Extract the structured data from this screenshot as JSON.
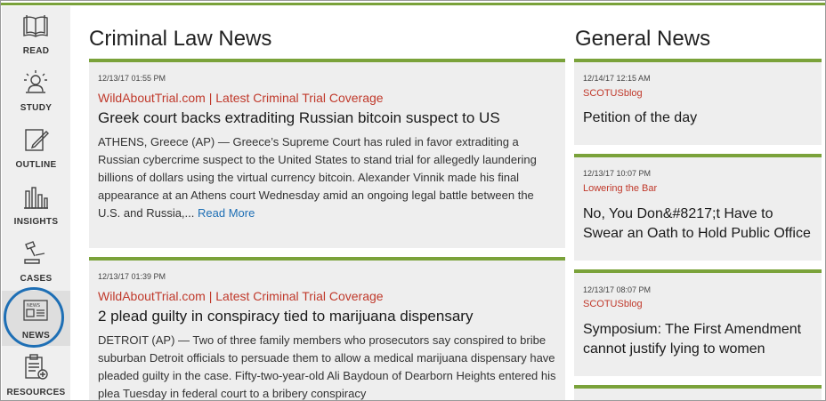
{
  "sidebar": {
    "items": [
      {
        "label": "READ",
        "icon": "book-icon"
      },
      {
        "label": "STUDY",
        "icon": "study-lamp-icon"
      },
      {
        "label": "OUTLINE",
        "icon": "outline-pencil-icon"
      },
      {
        "label": "INSIGHTS",
        "icon": "bar-chart-icon"
      },
      {
        "label": "CASES",
        "icon": "gavel-icon"
      },
      {
        "label": "NEWS",
        "icon": "newspaper-icon"
      },
      {
        "label": "RESOURCES",
        "icon": "clipboard-plus-icon"
      }
    ],
    "active": "NEWS"
  },
  "criminal": {
    "title": "Criminal Law News",
    "articles": [
      {
        "timestamp": "12/13/17 01:55 PM",
        "source": "WildAboutTrial.com | Latest Criminal Trial Coverage",
        "headline": "Greek court backs extraditing Russian bitcoin suspect to US",
        "summary": "ATHENS, Greece (AP) — Greece’s Supreme Court has ruled in favor extraditing a Russian cybercrime suspect to the United States to stand trial for allegedly laundering billions of dollars using the virtual currency bitcoin. Alexander Vinnik made his final appearance at an Athens court Wednesday amid an ongoing legal battle between the U.S. and Russia,...",
        "read_more": "Read More"
      },
      {
        "timestamp": "12/13/17 01:39 PM",
        "source": "WildAboutTrial.com | Latest Criminal Trial Coverage",
        "headline": "2 plead guilty in conspiracy tied to marijuana dispensary",
        "summary": "DETROIT (AP) — Two of three family members who prosecutors say conspired to bribe suburban Detroit officials to persuade them to allow a medical marijuana dispensary have pleaded guilty in the case. Fifty-two-year-old Ali Baydoun of Dearborn Heights entered his plea Tuesday in federal court to a bribery conspiracy"
      }
    ]
  },
  "general": {
    "title": "General News",
    "articles": [
      {
        "timestamp": "12/14/17 12:15 AM",
        "source": "SCOTUSblog",
        "headline": "Petition of the day"
      },
      {
        "timestamp": "12/13/17 10:07 PM",
        "source": "Lowering the Bar",
        "headline": "No, You Don&#8217;t Have to Swear an Oath to Hold Public Office"
      },
      {
        "timestamp": "12/13/17 08:07 PM",
        "source": "SCOTUSblog",
        "headline": "Symposium: The First Amendment cannot justify lying to women"
      }
    ]
  },
  "colors": {
    "accent": "#7aa23a",
    "source": "#c0392b",
    "link": "#1e6fb5",
    "ring": "#1e6fb5"
  }
}
